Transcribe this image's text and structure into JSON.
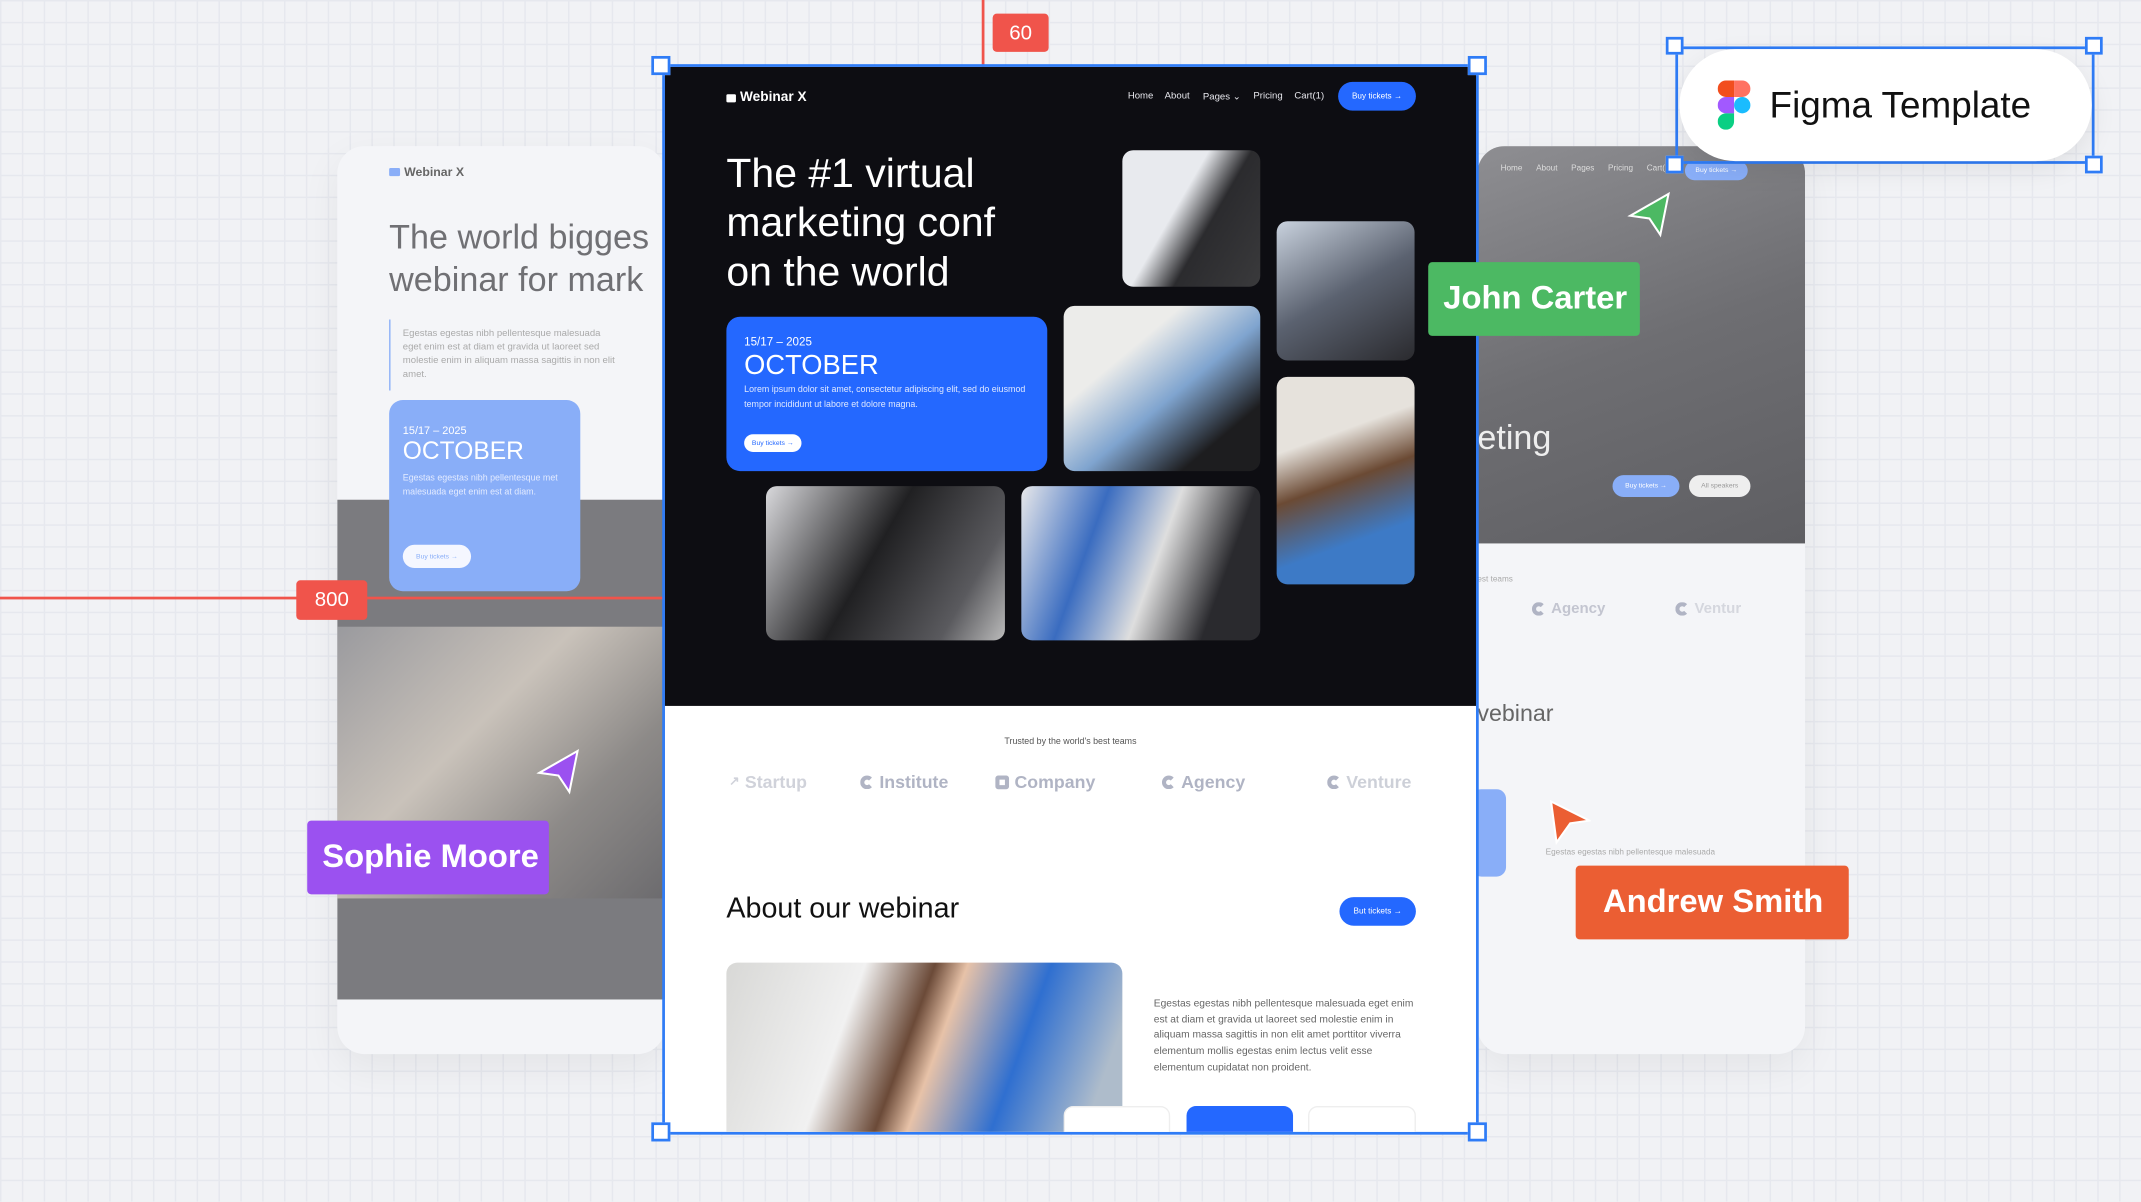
{
  "canvas": {
    "width_marker": "60",
    "height_marker": "800",
    "guide_color": "#f0544b"
  },
  "badge": {
    "title": "Figma Template"
  },
  "cursors": [
    {
      "name": "John Carter",
      "color": "#4cb963"
    },
    {
      "name": "Sophie Moore",
      "color": "#9b51f0"
    },
    {
      "name": "Andrew Smith",
      "color": "#eb5e33"
    }
  ],
  "site": {
    "brand": "Webinar X",
    "nav": [
      "Home",
      "About",
      "Pages",
      "Pricing",
      "Cart(1)"
    ],
    "nav_button": "Buy tickets →",
    "hero_lines": [
      "The #1 virtual",
      "marketing conf",
      "on the world"
    ],
    "event": {
      "date": "15/17 – 2025",
      "month": "OCTOBER",
      "text": "Lorem ipsum dolor sit amet, consectetur adipiscing elit, sed do eiusmod tempor incididunt ut labore et dolore magna.",
      "button": "Buy tickets →"
    },
    "trusted": "Trusted by the world's best teams",
    "logos": [
      "Startup",
      "Institute",
      "Company",
      "Agency",
      "Venture"
    ],
    "about_title": "About our webinar",
    "about_button": "But tickets →",
    "about_text": "Egestas egestas nibh pellentesque malesuada eget enim est at diam et gravida ut laoreet sed molestie enim in aliquam massa sagittis in non elit amet porttitor viverra elementum mollis egestas enim lectus velit esse elementum cupidatat non proident."
  },
  "left_variant": {
    "brand": "Webinar X",
    "hero": [
      "The world bigges",
      "webinar for mark"
    ],
    "text": "Egestas egestas nibh pellentesque malesuada eget enim est at diam et gravida ut laoreet sed molestie enim in aliquam massa sagittis in non elit amet.",
    "event": {
      "date": "15/17 – 2025",
      "month": "OCTOBER",
      "text": "Egestas egestas nibh pellentesque met malesuada eget enim est at diam.",
      "button": "Buy tickets →"
    }
  },
  "right_variant": {
    "nav": [
      "Home",
      "About",
      "Pages",
      "Pricing",
      "Cart("
    ],
    "nav_button": "Buy tickets →",
    "hero_fragment": "eting",
    "buttons": [
      "Buy tickets →",
      "All speakers"
    ],
    "trusted_fragment": "est teams",
    "logos": [
      "Agency",
      "Ventur"
    ],
    "about_fragment": "vebinar",
    "text_fragment": "Egestas egestas nibh pellentesque malesuada"
  }
}
